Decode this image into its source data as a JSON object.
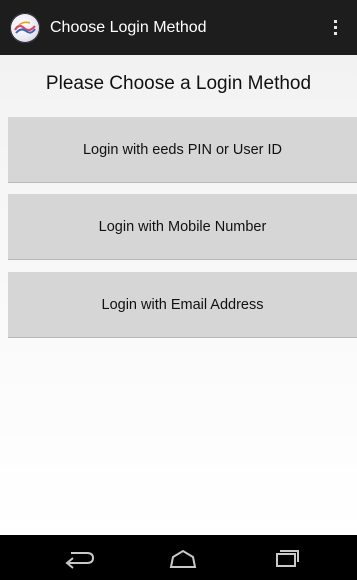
{
  "app_bar": {
    "title": "Choose Login Method",
    "logo_icon": "eeds-logo",
    "overflow_icon": "overflow-menu-icon"
  },
  "main": {
    "heading": "Please Choose a Login Method",
    "buttons": [
      {
        "label": "Login with eeds PIN or User ID"
      },
      {
        "label": "Login with Mobile Number"
      },
      {
        "label": "Login with Email Address"
      }
    ]
  },
  "nav_bar": {
    "icons": [
      "back-icon",
      "home-icon",
      "recent-apps-icon"
    ]
  },
  "colors": {
    "app_bar_bg": "#1d1d1d",
    "button_bg": "#d6d6d6",
    "nav_bar_bg": "#000000"
  }
}
